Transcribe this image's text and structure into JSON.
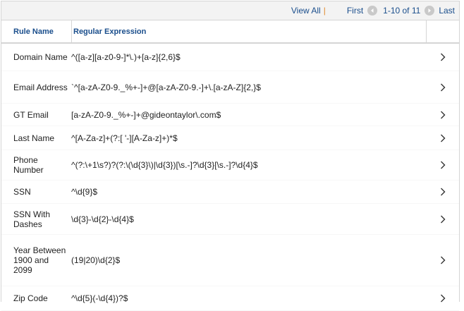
{
  "nav": {
    "view_all": "View All",
    "separator": "|",
    "first": "First",
    "range": "1-10 of 11",
    "last": "Last"
  },
  "headers": {
    "rule_name": "Rule Name",
    "regex": "Regular Expression"
  },
  "rows": [
    {
      "name": "Domain Name",
      "regex": "^([a-z][a-z0-9-]*\\.)+[a-z]{2,6}$"
    },
    {
      "name": "Email Address",
      "regex": "`^[a-zA-Z0-9._%+-]+@[a-zA-Z0-9.-]+\\.[a-zA-Z]{2,}$"
    },
    {
      "name": "GT Email",
      "regex": "[a-zA-Z0-9._%+-]+@gideontaylor\\.com$"
    },
    {
      "name": "Last Name",
      "regex": "^[A-Za-z]+(?:[ '-][A-Za-z]+)*$"
    },
    {
      "name": "Phone Number",
      "regex": "^(?:\\+1\\s?)?(?:\\(\\d{3}\\)|\\d{3})[\\s.-]?\\d{3}[\\s.-]?\\d{4}$"
    },
    {
      "name": "SSN",
      "regex": "^\\d{9}$"
    },
    {
      "name": "SSN With Dashes",
      "regex": "\\d{3}-\\d{2}-\\d{4}$"
    },
    {
      "name": "Year Between 1900 and 2099",
      "regex": "(19|20)\\d{2}$"
    },
    {
      "name": "Zip Code",
      "regex": "^\\d{5}(-\\d{4})?$"
    }
  ],
  "icons": {
    "prev": "arrow-left-icon",
    "next": "arrow-right-icon",
    "row_action": "chevron-right-icon"
  },
  "colors": {
    "link": "#1a4e8c",
    "separator": "#e08a2c",
    "header_bg": "#f3f3f3",
    "border": "#d5d5d5"
  }
}
